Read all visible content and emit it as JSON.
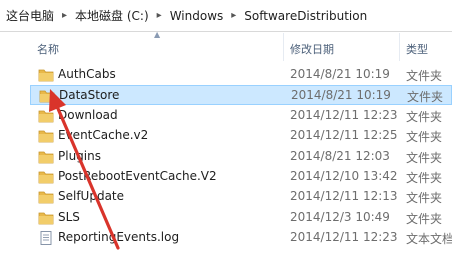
{
  "breadcrumb": [
    "这台电脑",
    "本地磁盘 (C:)",
    "Windows",
    "SoftwareDistribution"
  ],
  "columns": {
    "name": "名称",
    "date": "修改日期",
    "type": "类型"
  },
  "files": [
    {
      "name": "AuthCabs",
      "date": "2014/8/21 10:19",
      "type": "文件夹",
      "icon": "folder-icon"
    },
    {
      "name": "DataStore",
      "date": "2014/8/21 10:19",
      "type": "文件夹",
      "icon": "folder-icon",
      "selected": true
    },
    {
      "name": "Download",
      "date": "2014/12/11 12:23",
      "type": "文件夹",
      "icon": "folder-icon"
    },
    {
      "name": "EventCache.v2",
      "date": "2014/12/11 12:25",
      "type": "文件夹",
      "icon": "folder-icon"
    },
    {
      "name": "Plugins",
      "date": "2014/8/21 12:03",
      "type": "文件夹",
      "icon": "folder-icon"
    },
    {
      "name": "PostRebootEventCache.V2",
      "date": "2014/12/10 13:42",
      "type": "文件夹",
      "icon": "folder-icon"
    },
    {
      "name": "SelfUpdate",
      "date": "2014/12/11 12:13",
      "type": "文件夹",
      "icon": "folder-icon"
    },
    {
      "name": "SLS",
      "date": "2014/12/3 10:49",
      "type": "文件夹",
      "icon": "folder-icon"
    },
    {
      "name": "ReportingEvents.log",
      "date": "2014/12/11 12:23",
      "type": "文本文档",
      "icon": "text-file-icon"
    }
  ],
  "colors": {
    "selection": "#cce8ff",
    "selection_border": "#99d1ff",
    "folder": "#e8b84a",
    "annotation_arrow": "#d9342b"
  }
}
